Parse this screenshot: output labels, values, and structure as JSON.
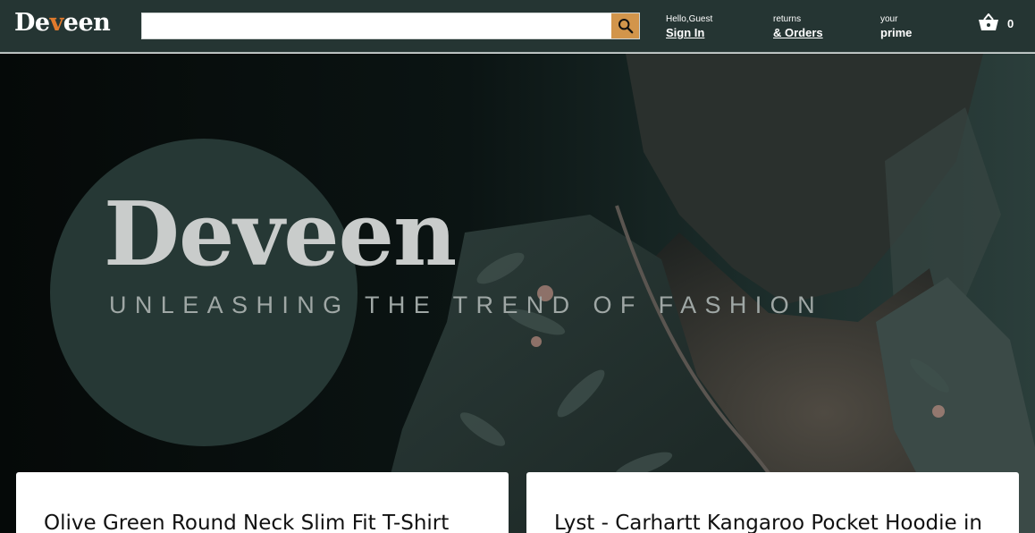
{
  "header": {
    "logo": {
      "prefix": "De",
      "accent": "v",
      "suffix": "een"
    },
    "search": {
      "value": "",
      "placeholder": ""
    },
    "account": {
      "greeting": "Hello,Guest",
      "action": "Sign In"
    },
    "orders": {
      "line1": "returns",
      "line2": "& Orders"
    },
    "prime": {
      "line1": "your",
      "line2": "prime"
    },
    "cart": {
      "count": "0"
    }
  },
  "hero": {
    "title": "Deveen",
    "subtitle": "UNLEASHING THE TREND OF FASHION"
  },
  "products": [
    {
      "title": "Olive Green Round Neck Slim Fit T-Shirt"
    },
    {
      "title": "Lyst - Carhartt Kangaroo Pocket Hoodie in"
    }
  ],
  "colors": {
    "header_bg": "#253533",
    "accent": "#e07a2c",
    "search_button": "#d2954b",
    "hero_circle": "#263835"
  }
}
